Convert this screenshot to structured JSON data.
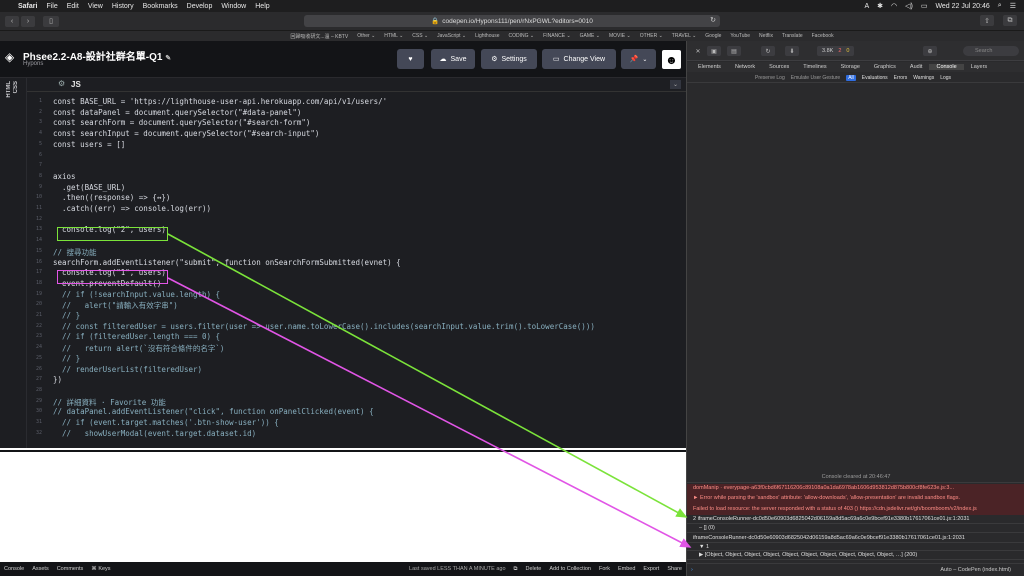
{
  "menubar": {
    "app": "Safari",
    "items": [
      "File",
      "Edit",
      "View",
      "History",
      "Bookmarks",
      "Develop",
      "Window",
      "Help"
    ],
    "datetime": "Wed 22 Jul  20:46"
  },
  "browser": {
    "url": "codepen.io/Hypons111/pen/rNxPGWL?editors=0010",
    "favorites": [
      "回歸吸收研文...溫 – KBTV",
      "Other ⌄",
      "HTML ⌄",
      "CSS ⌄",
      "JavaScript ⌄",
      "Lighthouse",
      "CODING ⌄",
      "FINANCE ⌄",
      "GAME ⌄",
      "MOVIE ⌄",
      "OTHER ⌄",
      "TRAVEL ⌄",
      "Google",
      "YouTube",
      "Netflix",
      "Translate",
      "Facebook"
    ]
  },
  "codepen": {
    "pen_title": "Phsee2.2-A8-設計社群名單-Q1",
    "author": "Hypons",
    "save_label": "Save",
    "settings_label": "Settings",
    "change_view_label": "Change View",
    "side_labels": [
      "HTML",
      "CSS"
    ],
    "editor_label": "JS"
  },
  "code_lines": [
    {
      "n": "1",
      "text": "const BASE_URL = 'https://lighthouse-user-api.herokuapp.com/api/v1/users/'"
    },
    {
      "n": "2",
      "text": "const dataPanel = document.querySelector(\"#data-panel\")"
    },
    {
      "n": "3",
      "text": "const searchForm = document.querySelector(\"#search-form\")"
    },
    {
      "n": "4",
      "text": "const searchInput = document.querySelector(\"#search-input\")"
    },
    {
      "n": "5",
      "text": "const users = []"
    },
    {
      "n": "6",
      "text": ""
    },
    {
      "n": "7",
      "text": ""
    },
    {
      "n": "8",
      "text": "axios"
    },
    {
      "n": "9",
      "text": "  .get(BASE_URL)"
    },
    {
      "n": "10",
      "text": "  .then((response) => {↔})"
    },
    {
      "n": "11",
      "text": "  .catch((err) => console.log(err))"
    },
    {
      "n": "12",
      "text": ""
    },
    {
      "n": "13",
      "text": "  console.log(\"2\", users)"
    },
    {
      "n": "14",
      "text": ""
    },
    {
      "n": "15",
      "text": "// 搜尋功能"
    },
    {
      "n": "16",
      "text": "searchForm.addEventListener(\"submit\", function onSearchFormSubmitted(evnet) {"
    },
    {
      "n": "17",
      "text": "  console.log(\"1\", users)"
    },
    {
      "n": "18",
      "text": "  event.preventDefault()"
    },
    {
      "n": "19",
      "text": "  // if (!searchInput.value.length) {"
    },
    {
      "n": "20",
      "text": "  //   alert(\"請輸入有效字串\")"
    },
    {
      "n": "21",
      "text": "  // }"
    },
    {
      "n": "22",
      "text": "  // const filteredUser = users.filter(user => user.name.toLowerCase().includes(searchInput.value.trim().toLowerCase()))"
    },
    {
      "n": "23",
      "text": "  // if (filteredUser.length === 0) {"
    },
    {
      "n": "24",
      "text": "  //   return alert(`沒有符合條件的名字`)"
    },
    {
      "n": "25",
      "text": "  // }"
    },
    {
      "n": "26",
      "text": "  // renderUserList(filteredUser)"
    },
    {
      "n": "27",
      "text": "})"
    },
    {
      "n": "28",
      "text": ""
    },
    {
      "n": "29",
      "text": "// 詳細資料 · Favorite 功能"
    },
    {
      "n": "30",
      "text": "// dataPanel.addEventListener(\"click\", function onPanelClicked(event) {"
    },
    {
      "n": "31",
      "text": "  // if (event.target.matches('.btn-show-user')) {"
    },
    {
      "n": "32",
      "text": "  //   showUserModal(event.target.dataset.id)"
    }
  ],
  "footer": {
    "left": [
      "Console",
      "Assets",
      "Comments",
      "⌘ Keys"
    ],
    "last_saved": "Last saved LESS THAN A MINUTE ago",
    "right": [
      "Delete",
      "Add to Collection",
      "Fork",
      "Embed",
      "Export",
      "Share"
    ]
  },
  "devtools": {
    "counts": {
      "resources": "3.8K",
      "errors": "2",
      "warnings": "0"
    },
    "search_placeholder": "Search",
    "tabs": [
      "Elements",
      "Network",
      "Sources",
      "Timelines",
      "Storage",
      "Graphics",
      "Audit",
      "Console",
      "Layers"
    ],
    "active_tab": "Console",
    "filter": [
      "Preserve Log",
      "Emulate User Gesture",
      "All",
      "Evaluations",
      "Errors",
      "Warnings",
      "Logs"
    ],
    "cleared": "Console cleared at 20:46:47",
    "messages": [
      {
        "kind": "error",
        "text": "domManip · everypage-a63f0cbd6f67116206c89108a0a1da6978ab1606d953812d875b800cf8fe623e.js:3..."
      },
      {
        "kind": "error",
        "text": "► Error while parsing the 'sandbox' attribute: 'allow-downloads', 'allow-presentation' are invalid sandbox flags."
      },
      {
        "kind": "error",
        "text": "Failed to load resource: the server responded with a status of 403 ()    https://cdn.jsdelivr.net/gh/boomboom/v2/index.js"
      },
      {
        "kind": "log",
        "text": "2  iframeConsoleRunner-dc0d50e60903d6825042d06159a8d5ac69a6c0e9bcef91e3380b17617061ce01.js:1:2031"
      },
      {
        "kind": "log",
        "text": "– [] (0)"
      },
      {
        "kind": "log",
        "text": "iframeConsoleRunner-dc0d50e60903d6825042d06159a8d5ac69a6c0e9bcef91e3380b17617061ce01.js:1:2031"
      },
      {
        "kind": "log",
        "text": "▼ 1"
      },
      {
        "kind": "log",
        "text": "▶ [Object, Object, Object, Object, Object, Object, Object, Object, Object, Object, …] (200)"
      }
    ],
    "context": "Auto – CodePen (index.html)"
  },
  "annotation_colors": {
    "green": "#7be33a",
    "magenta": "#e155e6"
  }
}
